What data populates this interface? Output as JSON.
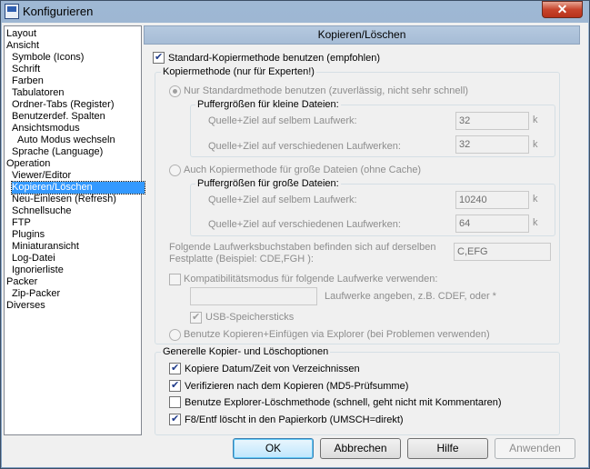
{
  "window": {
    "title": "Konfigurieren",
    "close_glyph": "✕"
  },
  "tree": {
    "items": [
      "Layout",
      "Ansicht",
      "Symbole (Icons)",
      "Schrift",
      "Farben",
      "Tabulatoren",
      "Ordner-Tabs (Register)",
      "Benutzerdef. Spalten",
      "Ansichtsmodus",
      "Auto Modus wechseln",
      "Sprache (Language)",
      "Operation",
      "Viewer/Editor",
      "Kopieren/Löschen",
      "Neu-Einlesen (Refresh)",
      "Schnellsuche",
      "FTP",
      "Plugins",
      "Miniaturansicht",
      "Log-Datei",
      "Ignorierliste",
      "Packer",
      "Zip-Packer",
      "Diverses"
    ],
    "selected": "Kopieren/Löschen"
  },
  "panel": {
    "header": "Kopieren/Löschen",
    "standard_method_label": "Standard-Kopiermethode benutzen (empfohlen)",
    "copy_method_group": "Kopiermethode (nur für Experten!)",
    "only_standard_label": "Nur Standardmethode benutzen (zuverlässig, nicht sehr schnell)",
    "small_buffers_group": "Puffergrößen für kleine Dateien:",
    "same_drive_label": "Quelle+Ziel auf selbem Laufwerk:",
    "diff_drive_label": "Quelle+Ziel auf verschiedenen Laufwerken:",
    "small_same_value": "32",
    "small_diff_value": "32",
    "unit_k": "k",
    "big_method_label": "Auch Kopiermethode für große Dateien (ohne Cache)",
    "big_buffers_group": "Puffergrößen für große Dateien:",
    "big_same_value": "10240",
    "big_diff_value": "64",
    "same_disk_line1": "Folgende Laufwerksbuchstaben befinden sich auf derselben",
    "same_disk_line2": "Festplatte (Beispiel: CDE,FGH ):",
    "same_disk_value": "C,EFG",
    "compat_label": "Kompatibilitätsmodus für folgende Laufwerke verwenden:",
    "compat_value": "",
    "compat_hint": "Laufwerke angeben, z.B. CDEF, oder *",
    "usb_label": "USB-Speichersticks",
    "explorer_paste_label": "Benutze Kopieren+Einfügen via Explorer (bei Problemen verwenden)",
    "general_group": "Generelle Kopier- und Löschoptionen",
    "opt_copy_date": "Kopiere Datum/Zeit von Verzeichnissen",
    "opt_verify": "Verifizieren nach dem Kopieren (MD5-Prüfsumme)",
    "opt_explorer_delete": "Benutze Explorer-Löschmethode (schnell, geht nicht mit Kommentaren)",
    "opt_f8_delete": "F8/Entf löscht in den Papierkorb (UMSCH=direkt)"
  },
  "buttons": {
    "ok": "OK",
    "cancel": "Abbrechen",
    "help": "Hilfe",
    "apply": "Anwenden"
  }
}
